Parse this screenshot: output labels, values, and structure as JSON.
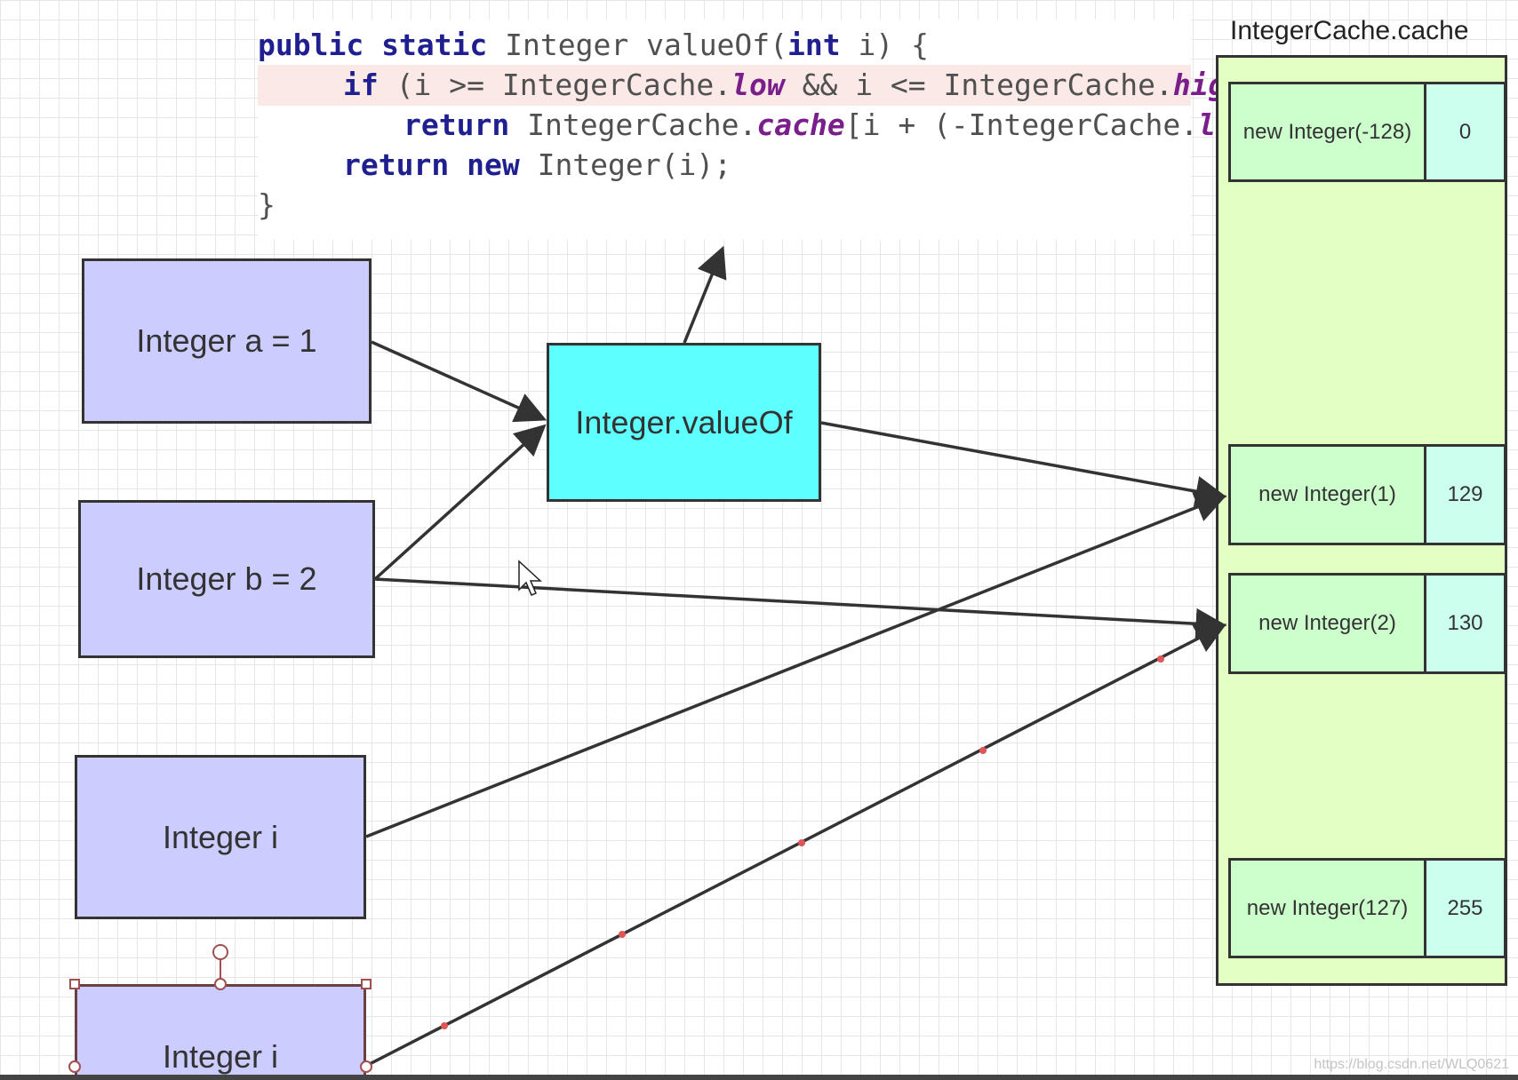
{
  "code": {
    "line1": {
      "kw1": "public static",
      "t1": " Integer valueOf(",
      "kw2": "int",
      "t2": " i) {"
    },
    "line2": {
      "kw1": "if",
      "t1": " (i >= IntegerCache.",
      "f1": "low",
      "t2": " && i <= IntegerCache.",
      "f2": "high",
      "t3": ")"
    },
    "line3": {
      "kw1": "return",
      "t1": " IntegerCache.",
      "f1": "cache",
      "t2": "[i + (-IntegerCache.",
      "f2": "low",
      "t3": ")];"
    },
    "line4": {
      "kw1": "return",
      "t1": " ",
      "kw2": "new",
      "t2": " Integer(i);"
    },
    "line5": {
      "t1": "}"
    }
  },
  "nodes": {
    "var_a": "Integer a = 1",
    "var_b": "Integer b = 2",
    "var_i1": "Integer i",
    "var_i2": "Integer i",
    "value_of": "Integer.valueOf"
  },
  "cache": {
    "title": "IntegerCache.cache",
    "entries": [
      {
        "object": "new Integer(-128)",
        "index": "0"
      },
      {
        "object": "new Integer(1)",
        "index": "129"
      },
      {
        "object": "new Integer(2)",
        "index": "130"
      },
      {
        "object": "new Integer(127)",
        "index": "255"
      }
    ]
  },
  "colors": {
    "variable_box": "#ccccff",
    "value_of_box": "#5effff",
    "cache_panel": "#e3ffc4",
    "cache_object": "#ccffcc",
    "cache_index": "#ccffee",
    "code_highlight": "#fbe9e7",
    "keyword": "#1f1f8f",
    "field": "#7a1e8c",
    "arrow": "#333333",
    "waypoint": "#e05555",
    "selection_handle": "#a05050"
  },
  "watermark": "https://blog.csdn.net/WLQ0621"
}
